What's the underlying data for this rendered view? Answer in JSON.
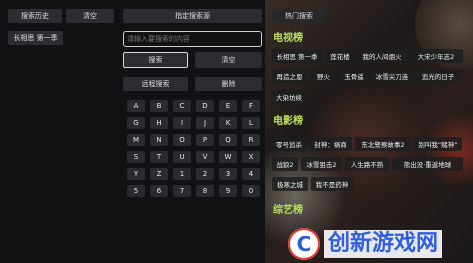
{
  "left_panel": {
    "history_button": "搜索历史",
    "clear_button": "清空",
    "history_items": [
      "长相思 第一季"
    ]
  },
  "middle_panel": {
    "search_source_button": "指定搜索源",
    "search_input_placeholder": "请输入要搜索的内容",
    "search_button": "搜索",
    "clear_button": "清空",
    "remote_search_button": "远程搜索",
    "delete_button": "删除",
    "keyboard_rows": [
      [
        "A",
        "B",
        "C",
        "D",
        "E",
        "F"
      ],
      [
        "G",
        "H",
        "I",
        "J",
        "K",
        "L"
      ],
      [
        "M",
        "N",
        "O",
        "P",
        "Q",
        "R"
      ],
      [
        "S",
        "T",
        "U",
        "V",
        "W",
        "X"
      ],
      [
        "Y",
        "Z",
        "1",
        "2",
        "3",
        "4"
      ],
      [
        "5",
        "6",
        "7",
        "8",
        "9",
        "0"
      ]
    ]
  },
  "right_panel": {
    "hot_search_title": "热门搜索",
    "tv_section": {
      "title": "电视榜",
      "items": [
        "长相思 第一季",
        "莲花楼",
        "我的人间烟火",
        "大宋少年志2",
        "再造之恩",
        "野火",
        "玉骨遥",
        "冰雪尖刀连",
        "追光的日子",
        "大染坊续"
      ]
    },
    "movie_section": {
      "title": "电影榜",
      "items": [
        "零号追杀",
        "封神：祸商",
        "东北警察故事2",
        "别叫我“赌神”",
        "战狼2",
        "冰雪狙击2",
        "人生路不熟",
        "熊出没·重返地球",
        "极寒之城",
        "我不是药神"
      ]
    },
    "variety_section": {
      "title": "综艺榜"
    }
  },
  "watermark": {
    "text": "创新游戏网",
    "logo_letter": "C"
  }
}
